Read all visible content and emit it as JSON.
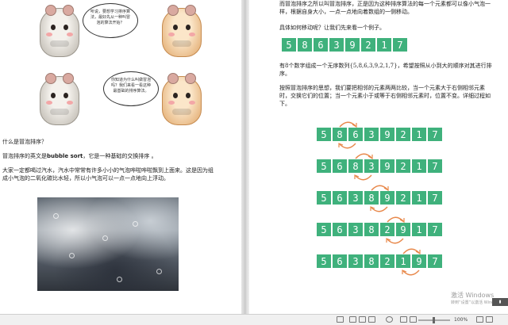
{
  "left": {
    "bubble1": "听说，要想学习排序算法，最好先从一种叫冒泡的算法开始？",
    "bubble2": "你知道为什么叫做冒泡吗？我们来看一看这种最基础的排序算法。",
    "question": "什么是冒泡排序？",
    "def_prefix": "冒泡排序的英文是",
    "def_term": "bubble sort",
    "def_suffix": "，它是一种基础的交换排序 。",
    "paragraph": "大家一定都喝过汽水，汽水中常常有许多小小的气泡哗啦哗啦飘到上面来。这是因为组成小气泡的二氧化碳比水轻，所以小气泡可以一点一点地向上浮动。"
  },
  "right": {
    "p1": "而冒泡排序之所以叫冒泡排序，正是因为这种排序算法的每一个元素都可以像小气泡一样，根据自身大小，一点一点地向着数组的一侧移动。",
    "p2": "具体如何移动呢？让我们先来看一个例子。",
    "p3": "有8个数字组成一个无序数列{5,8,6,3,9,2,1,7}，希望按照从小到大的顺序对其进行排序。",
    "p4": "按照冒泡排序的思想，我们要把相邻的元素两两比较，当一个元素大于右侧相邻元素时，交换它们的位置；当一个元素小于或等于右侧相邻元素时，位置不变。详细过程如下。",
    "initial": [
      "5",
      "8",
      "6",
      "3",
      "9",
      "2",
      "1",
      "7"
    ],
    "steps": [
      [
        "5",
        "8",
        "6",
        "3",
        "9",
        "2",
        "1",
        "7"
      ],
      [
        "5",
        "6",
        "8",
        "3",
        "9",
        "2",
        "1",
        "7"
      ],
      [
        "5",
        "6",
        "3",
        "8",
        "9",
        "2",
        "1",
        "7"
      ],
      [
        "5",
        "6",
        "3",
        "8",
        "2",
        "9",
        "1",
        "7"
      ],
      [
        "5",
        "6",
        "3",
        "8",
        "2",
        "1",
        "9",
        "7"
      ]
    ]
  },
  "watermark": {
    "title": "激活 Windows",
    "subtitle": "转到“设置”以激活 Windows。"
  },
  "statusbar": {
    "zoom": "100%"
  },
  "colors": {
    "cell": "#3fb17c",
    "arrow": "#e8884a"
  }
}
